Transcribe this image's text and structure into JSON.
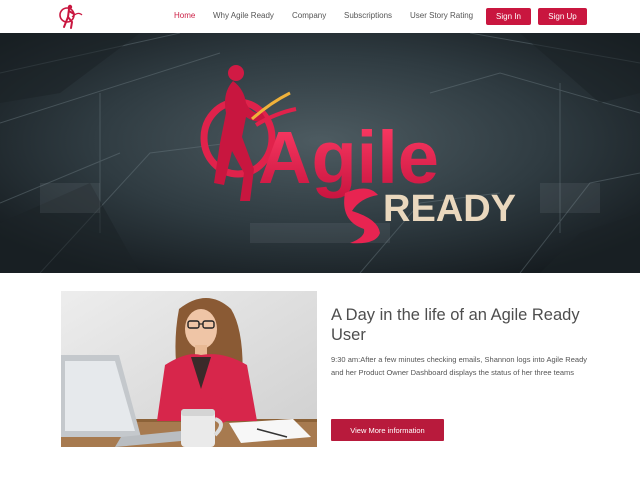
{
  "nav": {
    "links": [
      {
        "label": "Home",
        "active": true
      },
      {
        "label": "Why Agile Ready",
        "active": false
      },
      {
        "label": "Company",
        "active": false
      },
      {
        "label": "Subscriptions",
        "active": false
      },
      {
        "label": "User Story Rating",
        "active": false
      }
    ],
    "sign_in": "Sign In",
    "sign_up": "Sign Up"
  },
  "hero": {
    "logo_word": "Agile",
    "logo_sub": "READY"
  },
  "content": {
    "title": "A Day in the life of an Agile Ready User",
    "description": "9:30 am:After a few minutes checking emails, Shannon logs into Agile Ready and her Product Owner Dashboard displays the status of her three teams",
    "cta": "View More information"
  },
  "colors": {
    "brand": "#c9163f",
    "active_link": "#cc1f45",
    "logo_text": "#ee2a55",
    "ready_text": "#ead8be"
  }
}
